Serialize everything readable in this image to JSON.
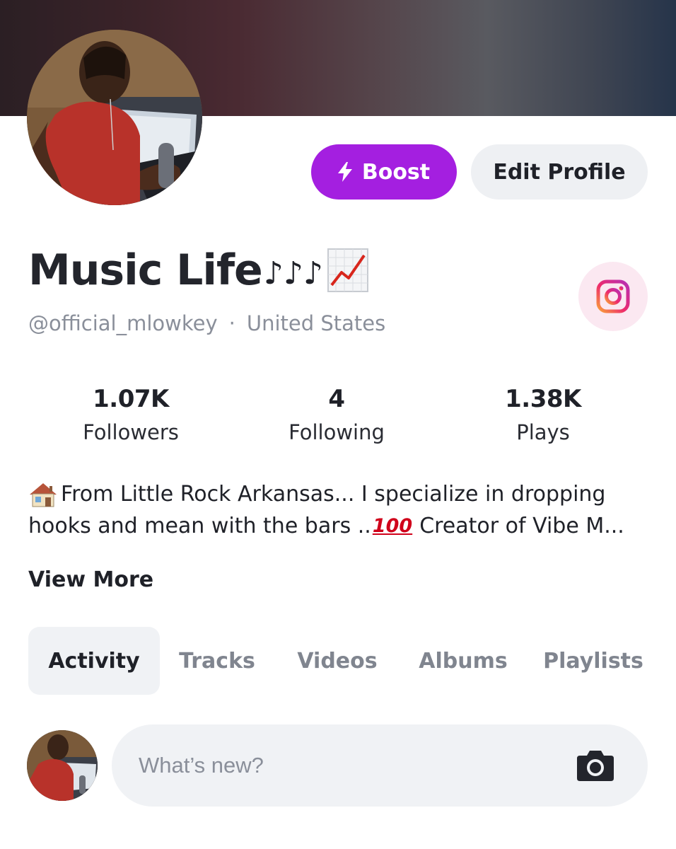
{
  "header": {
    "boost_label": "Boost",
    "edit_profile_label": "Edit Profile"
  },
  "profile": {
    "name": "Music Life",
    "name_suffix_notes": "♪♪♪",
    "handle": "@official_mlowkey",
    "separator": "·",
    "location": "United States",
    "social_icon": "instagram-icon"
  },
  "stats": [
    {
      "value": "1.07K",
      "label": "Followers"
    },
    {
      "value": "4",
      "label": "Following"
    },
    {
      "value": "1.38K",
      "label": "Plays"
    }
  ],
  "bio": {
    "line1": "From Little Rock Arkansas... I specialize in dropping",
    "line2_a": "hooks and mean with the bars ..",
    "hundred": "100",
    "line2_b": "Creator of Vibe M...",
    "view_more_label": "View More"
  },
  "tabs": [
    {
      "label": "Activity",
      "active": true
    },
    {
      "label": "Tracks",
      "active": false
    },
    {
      "label": "Videos",
      "active": false
    },
    {
      "label": "Albums",
      "active": false
    },
    {
      "label": "Playlists",
      "active": false
    }
  ],
  "composer": {
    "placeholder": "What’s new?",
    "value": ""
  },
  "colors": {
    "boost": "#a41fe0",
    "instagram_bg": "#fbe8f1",
    "pill_bg": "#f0f2f5",
    "muted_text": "#8a8f9a"
  }
}
